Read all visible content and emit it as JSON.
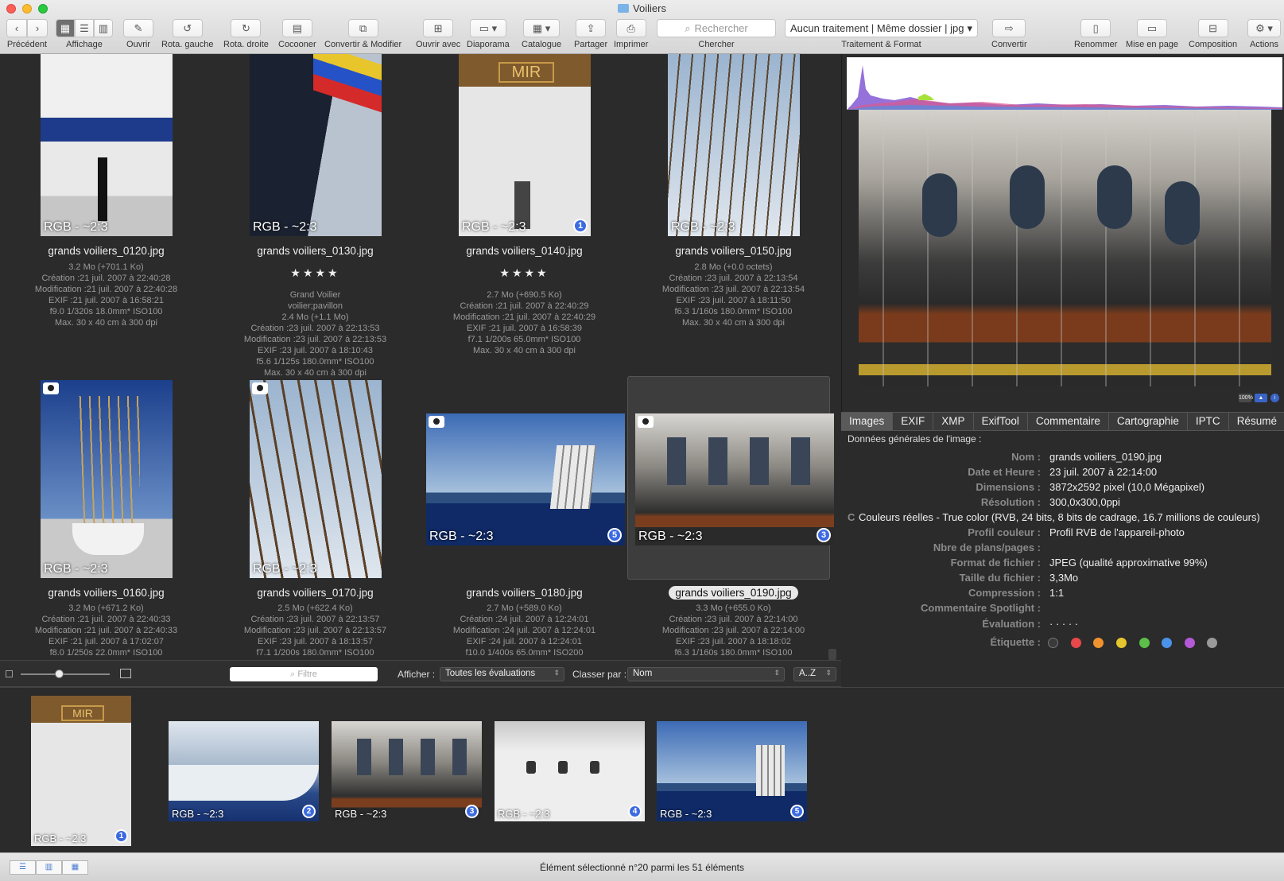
{
  "window": {
    "title": "Voiliers"
  },
  "toolbar": {
    "back_label": "Précédent",
    "view_label": "Affichage",
    "open_label": "Ouvrir",
    "rotate_left_label": "Rota. gauche",
    "rotate_right_label": "Rota. droite",
    "tag_label": "Cocooner",
    "convert_modify_label": "Convertir & Modifier",
    "open_with_label": "Ouvrir avec",
    "slideshow_label": "Diaporama",
    "catalog_label": "Catalogue",
    "share_label": "Partager",
    "print_label": "Imprimer",
    "search_placeholder": "Rechercher",
    "search_label": "Chercher",
    "processing_value": "Aucun traitement | Même dossier | jpg",
    "processing_label": "Traitement & Format",
    "convert_label": "Convertir",
    "rename_label": "Renommer",
    "layout_label": "Mise en page",
    "composition_label": "Composition",
    "actions_label": "Actions"
  },
  "grid": {
    "items": [
      {
        "name": "grands voiliers_0120.jpg",
        "badge": "RGB - ~2:3",
        "number": "",
        "stars": "",
        "meta": "3.2  Mo (+701.1 Ko)\nCréation :21 juil. 2007 à 22:40:28\nModification :21 juil. 2007 à 22:40:28\nEXIF :21 juil. 2007 à 16:58:21\nf9.0 1/320s 18.0mm* ISO100\nMax. 30 x 40 cm à 300 dpi"
      },
      {
        "name": "grands voiliers_0130.jpg",
        "badge": "RGB - ~2:3",
        "number": "",
        "stars": "★★★★",
        "meta": "Grand Voilier\nvoilier;pavillon\n2.4  Mo (+1.1  Mo)\nCréation :23 juil. 2007 à 22:13:53\nModification :23 juil. 2007 à 22:13:53\nEXIF :23 juil. 2007 à 18:10:43\nf5.6 1/125s 180.0mm* ISO100\nMax. 30 x 40 cm à 300 dpi"
      },
      {
        "name": "grands voiliers_0140.jpg",
        "badge": "RGB - ~2:3",
        "number": "1",
        "stars": "★★★★",
        "meta": "2.7  Mo (+690.5 Ko)\nCréation :21 juil. 2007 à 22:40:29\nModification :21 juil. 2007 à 22:40:29\nEXIF :21 juil. 2007 à 16:58:39\nf7.1 1/200s 65.0mm* ISO100\nMax. 30 x 40 cm à 300 dpi"
      },
      {
        "name": "grands voiliers_0150.jpg",
        "badge": "RGB - ~2:3",
        "number": "",
        "stars": "",
        "meta": "2.8  Mo (+0.0 octets)\nCréation :23 juil. 2007 à 22:13:54\nModification :23 juil. 2007 à 22:13:54\nEXIF :23 juil. 2007 à 18:11:50\nf6.3 1/160s 180.0mm* ISO100\nMax. 30 x 40 cm à 300 dpi"
      },
      {
        "name": "grands voiliers_0160.jpg",
        "badge": "RGB - ~2:3",
        "number": "",
        "stars": "",
        "meta": "3.2  Mo (+671.2 Ko)\nCréation :21 juil. 2007 à 22:40:33\nModification :21 juil. 2007 à 22:40:33\nEXIF :21 juil. 2007 à 17:02:07\nf8.0 1/250s 22.0mm* ISO100"
      },
      {
        "name": "grands voiliers_0170.jpg",
        "badge": "RGB - ~2:3",
        "number": "",
        "stars": "",
        "meta": "2.5  Mo (+622.4 Ko)\nCréation :23 juil. 2007 à 22:13:57\nModification :23 juil. 2007 à 22:13:57\nEXIF :23 juil. 2007 à 18:13:57\nf7.1 1/200s 180.0mm* ISO100"
      },
      {
        "name": "grands voiliers_0180.jpg",
        "badge": "RGB - ~2:3",
        "number": "5",
        "stars": "",
        "meta": "2.7  Mo (+589.0 Ko)\nCréation :24 juil. 2007 à 12:24:01\nModification :24 juil. 2007 à 12:24:01\nEXIF :24 juil. 2007 à 12:24:01\nf10.0 1/400s 65.0mm* ISO200"
      },
      {
        "name": "grands voiliers_0190.jpg",
        "badge": "RGB - ~2:3",
        "number": "3",
        "stars": "",
        "meta": "3.3  Mo (+655.0 Ko)\nCréation :23 juil. 2007 à 22:14:00\nModification :23 juil. 2007 à 22:14:00\nEXIF :23 juil. 2007 à 18:18:02\nf6.3 1/160s 180.0mm* ISO100"
      }
    ]
  },
  "filterbar": {
    "filter_placeholder": "Filtre",
    "show_label": "Afficher :",
    "show_value": "Toutes les évaluations",
    "sort_label": "Classer par :",
    "sort_value": "Nom",
    "order_value": "A..Z"
  },
  "preview": {
    "zoom": "100%"
  },
  "info": {
    "tabs": [
      "Images",
      "EXIF",
      "XMP",
      "ExifTool",
      "Commentaire",
      "Cartographie",
      "IPTC",
      "Résumé"
    ],
    "title": "Données générales de l'image :",
    "rows": [
      {
        "k": "Nom :",
        "v": "grands voiliers_0190.jpg"
      },
      {
        "k": "Date et Heure :",
        "v": "23 juil. 2007 à 22:14:00"
      },
      {
        "k": "Dimensions :",
        "v": "3872x2592 pixel (10,0 Mégapixel)"
      },
      {
        "k": "Résolution :",
        "v": "300,0x300,0ppi"
      },
      {
        "k": "C",
        "v": "Couleurs réelles - True color (RVB, 24 bits, 8 bits de cadrage, 16.7 millions de couleurs)"
      },
      {
        "k": "Profil couleur :",
        "v": "Profil RVB de l'appareil-photo"
      },
      {
        "k": "Nbre de plans/pages :",
        "v": ""
      },
      {
        "k": "Format de fichier :",
        "v": "JPEG (qualité approximative 99%)"
      },
      {
        "k": "Taille du fichier :",
        "v": "3,3Mo"
      },
      {
        "k": "Compression :",
        "v": "1:1"
      },
      {
        "k": "Commentaire Spotlight :",
        "v": ""
      },
      {
        "k": "Évaluation :",
        "v": "·   ·   ·   ·   ·"
      },
      {
        "k": "Étiquette :",
        "v": ""
      }
    ],
    "label_colors": [
      "#e8484a",
      "#f0922e",
      "#e6c62e",
      "#5bbf4a",
      "#4a93e8",
      "#b45ad6",
      "#9a9a9a"
    ]
  },
  "filmstrip": {
    "items": [
      {
        "badge": "RGB - ~2:3",
        "number": "1"
      },
      {
        "badge": "RGB - ~2:3",
        "number": "2"
      },
      {
        "badge": "RGB - ~2:3",
        "number": "3"
      },
      {
        "badge": "RGB - ~2:3",
        "number": "4"
      },
      {
        "badge": "RGB - ~2:3",
        "number": "5"
      }
    ]
  },
  "status": {
    "text": "Élément sélectionné n°20 parmi les 51 éléments"
  }
}
